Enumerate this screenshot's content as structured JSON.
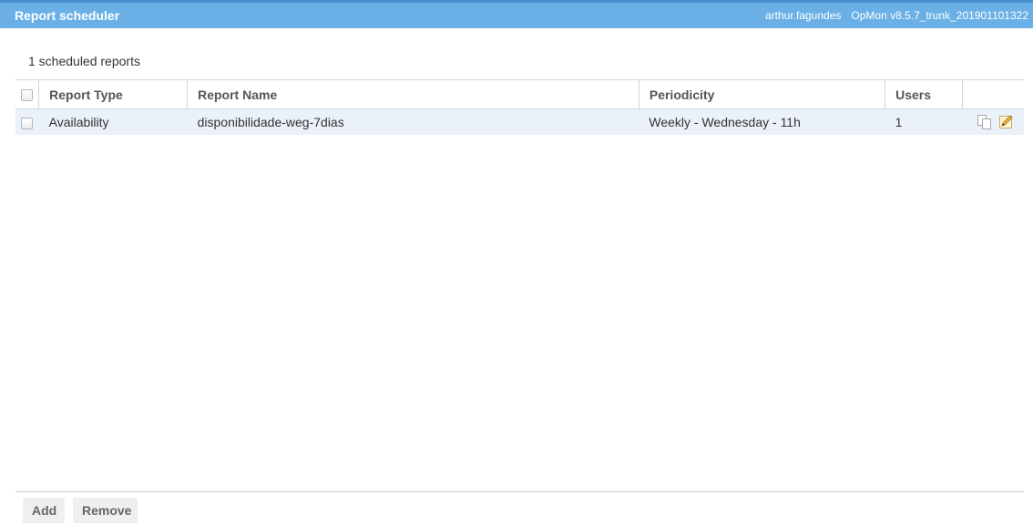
{
  "header": {
    "title": "Report scheduler",
    "username": "arthur.fagundes",
    "version": "OpMon v8.5.7_trunk_201901101322"
  },
  "summary": {
    "count_text": "1 scheduled reports"
  },
  "table": {
    "columns": [
      "Report Type",
      "Report Name",
      "Periodicity",
      "Users"
    ],
    "rows": [
      {
        "report_type": "Availability",
        "report_name": "disponibilidade-weg-7dias",
        "periodicity": "Weekly - Wednesday - 11h",
        "users": "1",
        "actions": [
          "copy-icon",
          "edit-pencil-icon"
        ]
      }
    ]
  },
  "footer": {
    "add_label": "Add",
    "remove_label": "Remove"
  },
  "colors": {
    "header_bg": "#6ab0e6",
    "header_border": "#4a90d0",
    "row_bg": "#eaf1f9",
    "button_bg": "#efefef"
  }
}
